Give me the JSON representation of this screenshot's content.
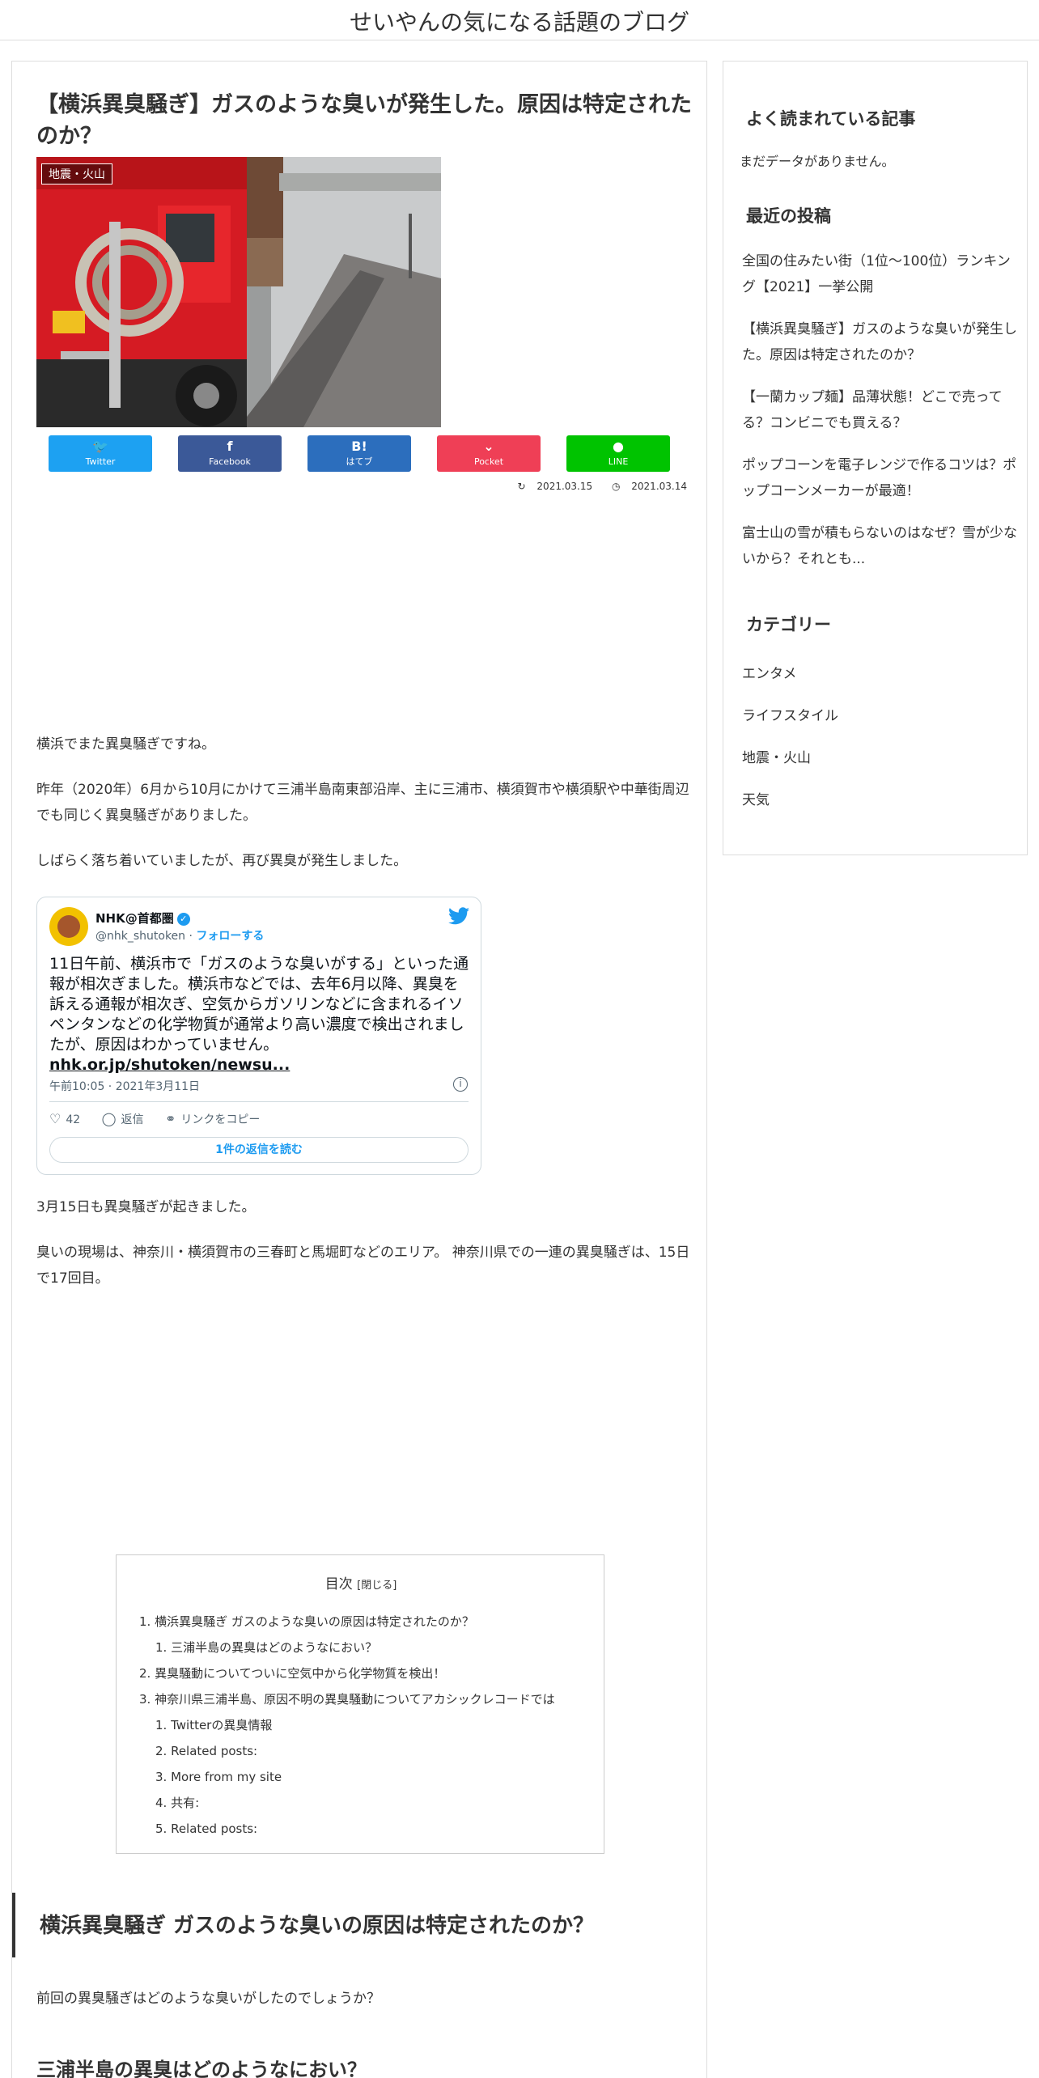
{
  "site": {
    "title": "せいやんの気になる話題のブログ"
  },
  "article": {
    "title": "【横浜異臭騒ぎ】ガスのような臭いが発生した。原因は特定されたのか？",
    "category_label": "地震・火山",
    "share": [
      {
        "icon": "twitter-icon",
        "glyph": "🐦",
        "label": "Twitter"
      },
      {
        "icon": "facebook-icon",
        "glyph": "f",
        "label": "Facebook"
      },
      {
        "icon": "hatena-icon",
        "glyph": "B!",
        "label": "はてブ"
      },
      {
        "icon": "pocket-icon",
        "glyph": "⌄",
        "label": "Pocket"
      },
      {
        "icon": "line-icon",
        "glyph": "●",
        "label": "LINE"
      }
    ],
    "updated_date": "2021.03.15",
    "published_date": "2021.03.14",
    "paragraphs": [
      "横浜でまた異臭騒ぎですね。",
      "昨年（2020年）6月から10月にかけて三浦半島南東部沿岸、主に三浦市、横須賀市や横須駅や中華街周辺でも同じく異臭騒ぎがありました。",
      "しばらく落ち着いていましたが、再び異臭が発生しました。",
      "3月15日も異臭騒ぎが起きました。",
      "臭いの現場は、神奈川・横須賀市の三春町と馬堀町などのエリア。 神奈川県での一連の異臭騒ぎは、15日で17回目。"
    ],
    "tweet": {
      "name": "NHK@首都圏",
      "handle": "@nhk_shutoken",
      "follow": "フォローする",
      "text": "11日午前、横浜市で「ガスのような臭いがする」といった通報が相次ぎました。横浜市などでは、去年6月以降、異臭を訴える通報が相次ぎ、空気からガソリンなどに含まれるイソペンタンなどの化学物質が通常より高い濃度で検出されましたが、原因はわかっていません。",
      "link": "nhk.or.jp/shutoken/newsu...",
      "time": "午前10:05 · 2021年3月11日",
      "likes": "42",
      "reply": "返信",
      "copy_link": "リンクをコピー",
      "read_replies": "1件の返信を読む"
    },
    "toc": {
      "title": "目次",
      "toggle": "[閉じる]",
      "items": [
        "1. 横浜異臭騒ぎ ガスのような臭いの原因は特定されたのか？",
        "1. 三浦半島の異臭はどのようなにおい？",
        "2. 異臭騒動についてついに空気中から化学物質を検出！",
        "3. 神奈川県三浦半島、原因不明の異臭騒動についてアカシックレコードでは",
        "1. Twitterの異臭情報",
        "2. Related posts:",
        "3. More from my site",
        "4. 共有:",
        "5. Related posts:"
      ]
    },
    "h2": "横浜異臭騒ぎ ガスのような臭いの原因は特定されたのか？",
    "after_h2": "前回の異臭騒ぎはどのような臭いがしたのでしょうか？",
    "h3": "三浦半島の異臭はどのようなにおい？"
  },
  "sidebar": {
    "popular_heading": "よく読まれている記事",
    "popular_empty": "まだデータがありません。",
    "recent_heading": "最近の投稿",
    "recent_posts": [
      "全国の住みたい街（1位～100位）ランキング【2021】一挙公開",
      "【横浜異臭騒ぎ】ガスのような臭いが発生した。原因は特定されたのか？",
      "【一蘭カップ麺】品薄状態！どこで売ってる？コンビニでも買える？",
      "ポップコーンを電子レンジで作るコツは？ポップコーンメーカーが最適！",
      "富士山の雪が積もらないのはなぜ？雪が少ないから？それとも..."
    ],
    "category_heading": "カテゴリー",
    "categories": [
      "エンタメ",
      "ライフスタイル",
      "地震・火山",
      "天気"
    ]
  },
  "colors": {
    "twitter": "#1da1f2",
    "facebook": "#3b5998",
    "hatena": "#2c6ebd",
    "pocket": "#ef3f56",
    "line": "#00c300"
  }
}
